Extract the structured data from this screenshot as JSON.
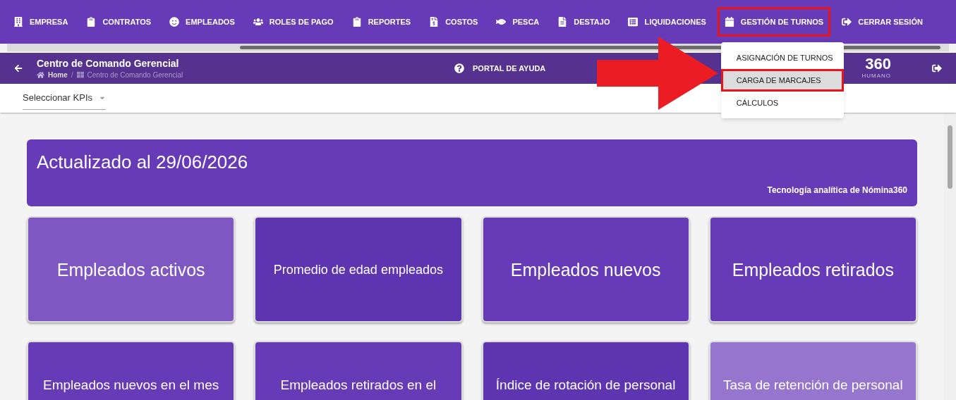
{
  "nav": {
    "items": [
      {
        "label": "EMPRESA",
        "highlighted": false
      },
      {
        "label": "CONTRATOS",
        "highlighted": false
      },
      {
        "label": "EMPLEADOS",
        "highlighted": false
      },
      {
        "label": "ROLES DE PAGO",
        "highlighted": false
      },
      {
        "label": "REPORTES",
        "highlighted": false
      },
      {
        "label": "COSTOS",
        "highlighted": false
      },
      {
        "label": "PESCA",
        "highlighted": false
      },
      {
        "label": "DESTAJO",
        "highlighted": false
      },
      {
        "label": "LIQUIDACIONES",
        "highlighted": false
      },
      {
        "label": "GESTIÓN DE TURNOS",
        "highlighted": true
      },
      {
        "label": "CERRAR SESIÓN",
        "highlighted": false
      }
    ],
    "menu": {
      "items": [
        {
          "label": "ASIGNACIÓN DE TURNOS",
          "selected": false,
          "highlighted": false
        },
        {
          "label": "CARGA DE MARCAJES",
          "selected": true,
          "highlighted": true
        },
        {
          "label": "CÁLCULOS",
          "selected": false,
          "highlighted": false
        }
      ]
    }
  },
  "header": {
    "title": "Centro de Comando Gerencial",
    "breadcrumb": [
      "Home",
      "/",
      "Centro de Comando Gerencial"
    ],
    "help": "PORTAL DE AYUDA",
    "logo_number": "360",
    "logo_caption": "HUMANO"
  },
  "kpi_select": {
    "placeholder": "Seleccionar KPIs"
  },
  "banner": {
    "title": "Actualizado al 29/06/2026",
    "caption": "Tecnología analítica de Nómina360"
  },
  "cards": [
    {
      "label": "Empleados activos",
      "color": "#7e57c2"
    },
    {
      "label": "Promedio de edad empleados",
      "color": "#5e35b1"
    },
    {
      "label": "Empleados nuevos",
      "color": "#673ab7"
    },
    {
      "label": "Empleados retirados",
      "color": "#673ab7"
    },
    {
      "label": "Empleados nuevos en el mes",
      "color": "#673ab7"
    },
    {
      "label": "Empleados retirados en el",
      "color": "#673ab7"
    },
    {
      "label": "Índice de rotación de personal",
      "color": "#5e35b1"
    },
    {
      "label": "Tasa de retención de personal",
      "color": "#9575cd"
    }
  ]
}
